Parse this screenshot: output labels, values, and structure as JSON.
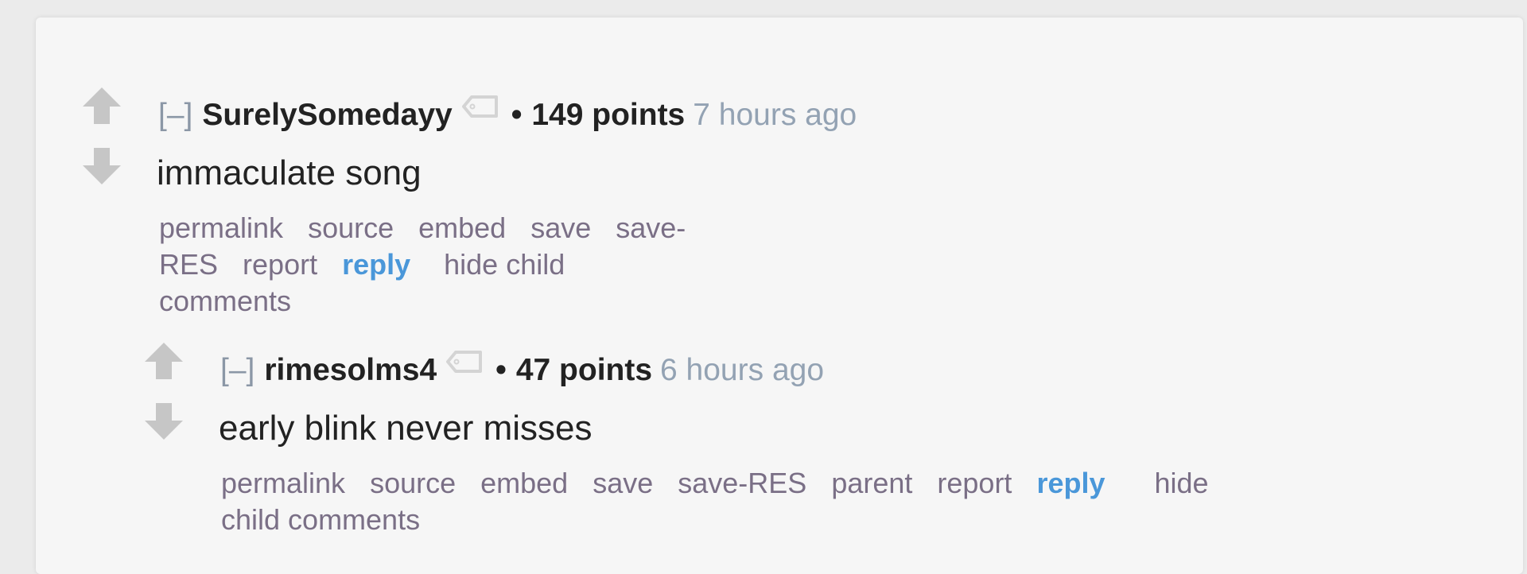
{
  "colors": {
    "background": "#ebebeb",
    "card": "#f6f6f6",
    "vote_arrow": "#c6c6c6",
    "author": "#222222",
    "time": "#93a2b3",
    "link": "#7a6f86",
    "reply": "#4a97d9"
  },
  "comments": [
    {
      "expand_label": "[–]",
      "author": "SurelySomedayy",
      "tag_icon": "tag-icon",
      "bullet": "•",
      "score": "149 points",
      "time": "7 hours ago",
      "body": "immaculate song",
      "actions": {
        "permalink": "permalink",
        "source": "source",
        "embed": "embed",
        "save": "save",
        "save_res": "save-RES",
        "report": "report",
        "reply": "reply",
        "hide_child": "hide child comments"
      }
    },
    {
      "expand_label": "[–]",
      "author": "rimesolms4",
      "tag_icon": "tag-icon",
      "bullet": "•",
      "score": "47 points",
      "time": "6 hours ago",
      "body": "early blink never misses",
      "actions": {
        "permalink": "permalink",
        "source": "source",
        "embed": "embed",
        "save": "save",
        "save_res": "save-RES",
        "parent": "parent",
        "report": "report",
        "reply": "reply",
        "hide_child": "hide child comments"
      }
    }
  ]
}
